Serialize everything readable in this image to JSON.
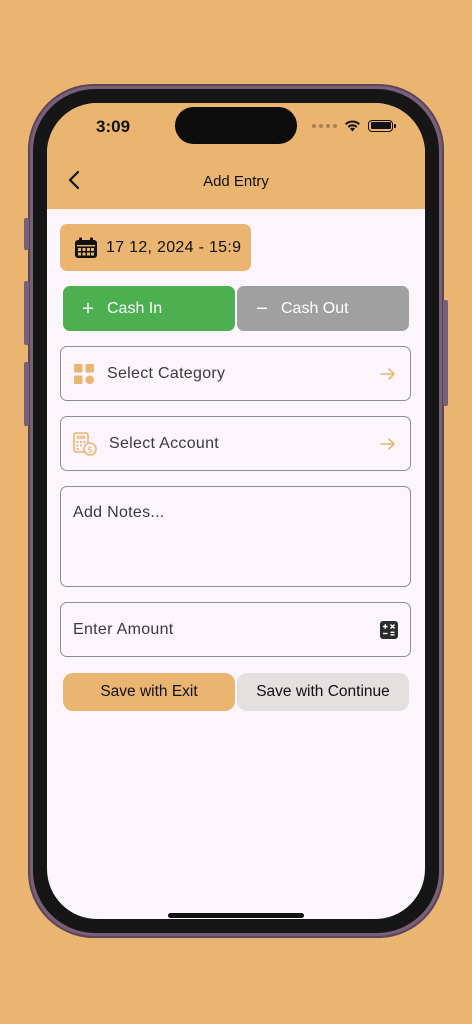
{
  "status_bar": {
    "time": "3:09"
  },
  "nav": {
    "title": "Add Entry"
  },
  "date_chip": {
    "text": "17 12, 2024 - 15:9"
  },
  "toggle": {
    "cash_in_label": "Cash In",
    "cash_out_label": "Cash Out",
    "selected": "Cash In"
  },
  "fields": {
    "category_label": "Select Category",
    "account_label": "Select Account",
    "notes_placeholder": "Add Notes...",
    "amount_placeholder": "Enter Amount"
  },
  "actions": {
    "save_exit_label": "Save with Exit",
    "save_continue_label": "Save with Continue"
  },
  "colors": {
    "accent": "#EAB471",
    "cash_in": "#4CB050",
    "cash_out": "#A0A0A0",
    "background": "#FCF6FC"
  },
  "icons": {
    "back": "chevron-left-icon",
    "date": "calendar-icon",
    "cash_in": "plus-icon",
    "cash_out": "minus-icon",
    "category": "grid-icon",
    "account": "calculator-dollar-icon",
    "arrow": "arrow-right-icon",
    "amount": "calculator-icon"
  }
}
